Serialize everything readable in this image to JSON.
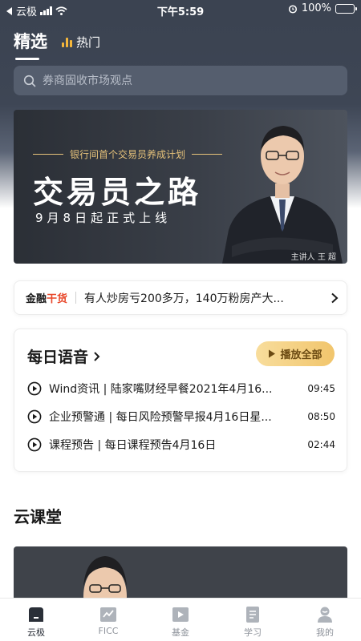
{
  "status_bar": {
    "back_app": "云极",
    "time": "下午5:59",
    "battery": "100%"
  },
  "top_tabs": [
    {
      "label": "精选",
      "active": true
    },
    {
      "label": "热门",
      "active": false
    }
  ],
  "search": {
    "placeholder": "券商固收市场观点"
  },
  "banner": {
    "subtitle": "银行间首个交易员养成计划",
    "title": "交易员之路",
    "date_line": "9月8日起正式上线",
    "presenter_caption": "主讲人 王 超"
  },
  "news": {
    "brand_part1": "金融",
    "brand_part2": "干货",
    "brand_accent_color": "#e8472a",
    "headline": "有人炒房亏200多万，140万粉房产大..."
  },
  "daily_audio": {
    "title": "每日语音",
    "play_all_label": "播放全部",
    "tracks": [
      {
        "title": "Wind资讯 | 陆家嘴财经早餐2021年4月16...",
        "duration": "09:45"
      },
      {
        "title": "企业预警通 | 每日风险预警早报4月16日星...",
        "duration": "08:50"
      },
      {
        "title": "课程预告 | 每日课程预告4月16日",
        "duration": "02:44"
      }
    ]
  },
  "cloud_class": {
    "title": "云课堂"
  },
  "bottom_nav": [
    {
      "label": "云极",
      "icon": "home-icon",
      "active": true
    },
    {
      "label": "FICC",
      "icon": "chart-icon",
      "active": false
    },
    {
      "label": "基金",
      "icon": "video-icon",
      "active": false
    },
    {
      "label": "学习",
      "icon": "book-icon",
      "active": false
    },
    {
      "label": "我的",
      "icon": "profile-icon",
      "active": false
    }
  ]
}
